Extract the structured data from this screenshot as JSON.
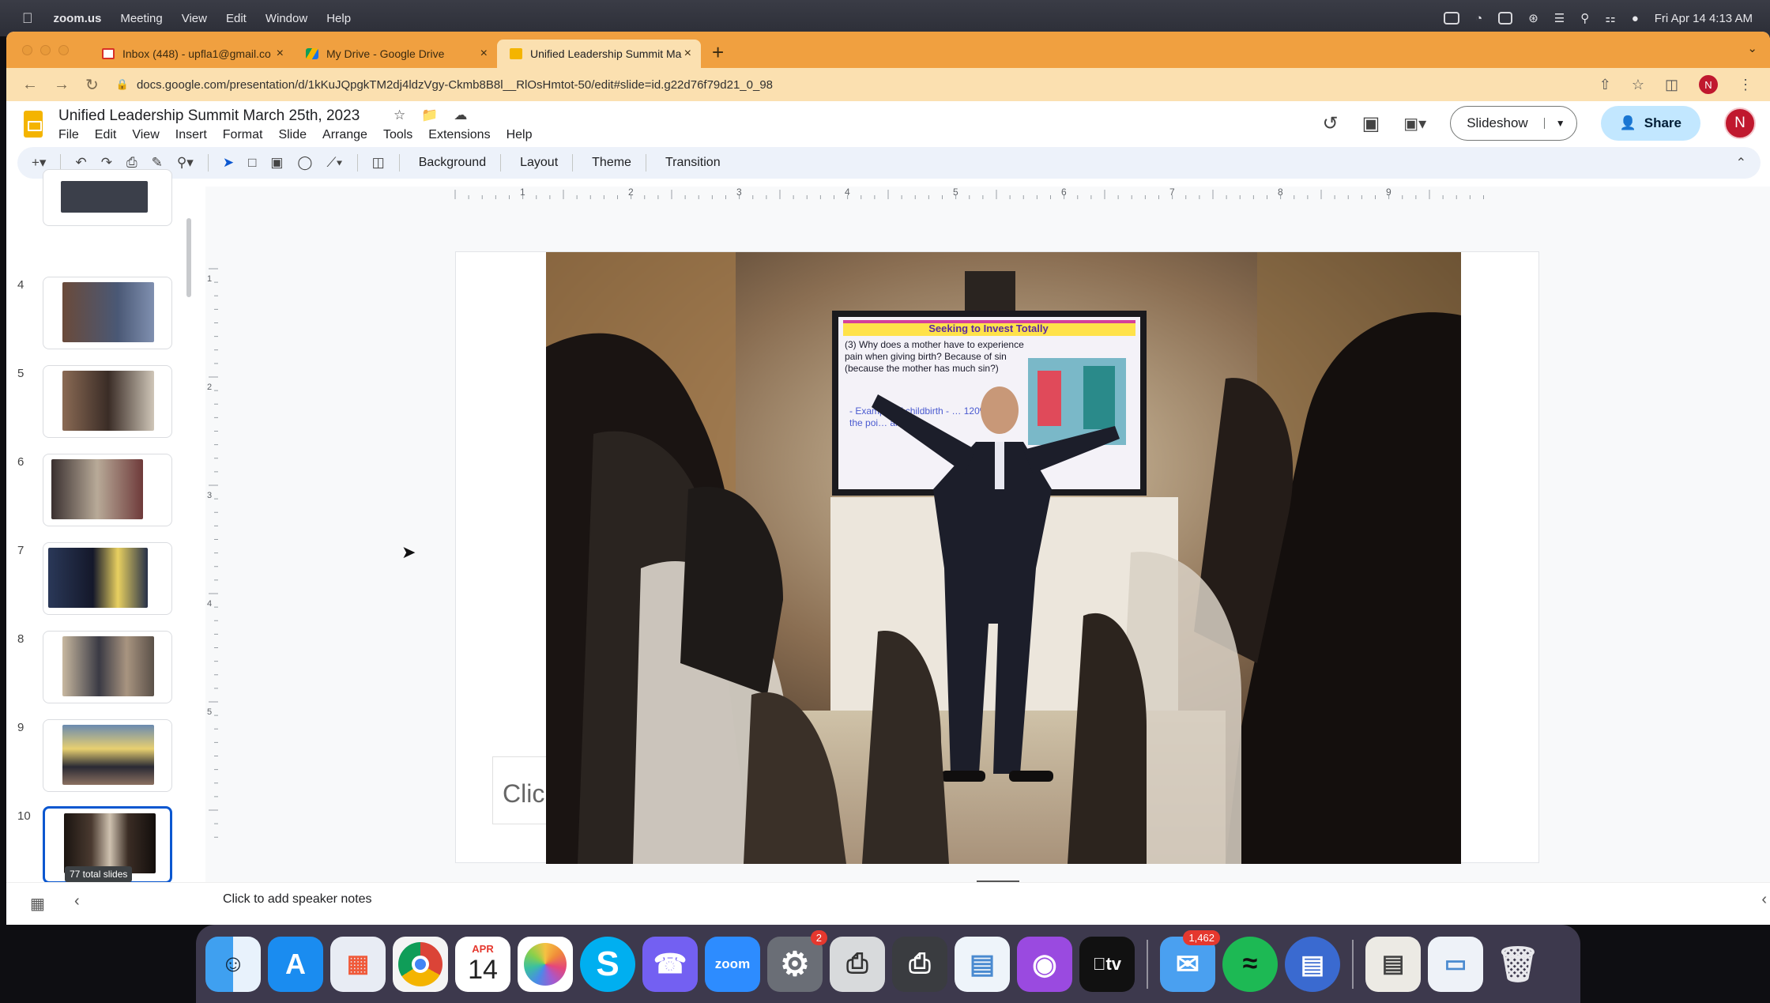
{
  "menubar": {
    "app": "zoom.us",
    "items": [
      "Meeting",
      "View",
      "Edit",
      "Window",
      "Help"
    ],
    "datetime": "Fri Apr 14  4:13 AM"
  },
  "tabs": [
    {
      "label": "Inbox (448) - upfla1@gmail.co",
      "icon": "gmail-icon",
      "color": "#d93025"
    },
    {
      "label": "My Drive - Google Drive",
      "icon": "drive-icon",
      "color": "#1a73e8"
    },
    {
      "label": "Unified Leadership Summit Ma",
      "icon": "slides-icon",
      "color": "#f4b400"
    }
  ],
  "address": {
    "url": "docs.google.com/presentation/d/1kKuJQpgkTM2dj4ldzVgy-Ckmb8B8l__RlOsHmtot-50/edit#slide=id.g22d76f79d21_0_98",
    "profile": "N"
  },
  "doc": {
    "title": "Unified Leadership Summit  March 25th, 2023",
    "menus": [
      "File",
      "Edit",
      "View",
      "Insert",
      "Format",
      "Slide",
      "Arrange",
      "Tools",
      "Extensions",
      "Help"
    ],
    "slideshow_label": "Slideshow",
    "share_label": "Share",
    "avatar": "N"
  },
  "toolbar": {
    "background": "Background",
    "layout": "Layout",
    "theme": "Theme",
    "transition": "Transition"
  },
  "filmstrip": {
    "slides": [
      {
        "num": "",
        "color": "#3b3f4a"
      },
      {
        "num": "4",
        "color": "#4a5875"
      },
      {
        "num": "5",
        "color": "#5a4a3e"
      },
      {
        "num": "6",
        "color": "#6e5a4a"
      },
      {
        "num": "7",
        "color": "#263048"
      },
      {
        "num": "8",
        "color": "#7a6a58"
      },
      {
        "num": "9",
        "color": "#4a6a8a"
      },
      {
        "num": "10",
        "color": "#2e2622"
      }
    ],
    "total": "77 total slides"
  },
  "ruler": {
    "h_labels": [
      "1",
      "2",
      "3",
      "4",
      "5",
      "6",
      "7",
      "8",
      "9"
    ],
    "v_labels": [
      "1",
      "2",
      "3",
      "4",
      "5"
    ]
  },
  "slide": {
    "screen_title": "Seeking to Invest Totally",
    "screen_body": "(3) Why does a mother have to experience pain when giving birth? Because of sin (because the mother has much sin?)",
    "screen_sub": "- Example of childbirth - … 120%, to the poi… and …th",
    "placeholder": "Clic"
  },
  "notes": {
    "label": "Click to add speaker notes"
  },
  "dock": {
    "calendar_month": "APR",
    "calendar_day": "14",
    "settings_badge": "2",
    "mail_badge": "1,462",
    "zoom_label": "zoom",
    "tv_label": "tv"
  }
}
